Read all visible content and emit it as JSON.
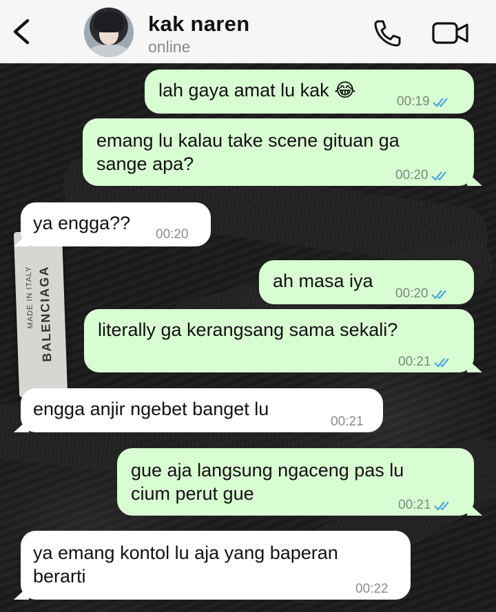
{
  "header": {
    "contact_name": "kak naren",
    "status": "online"
  },
  "wallpaper": {
    "tag_brand": "BALENCIAGA",
    "tag_subtext": "MADE IN ITALY"
  },
  "messages": [
    {
      "direction": "outgoing",
      "lines": [
        "lah gaya amat lu kak 😂"
      ],
      "time": "00:19",
      "read": true
    },
    {
      "direction": "outgoing",
      "lines": [
        "emang lu kalau take scene gituan ga",
        "sange apa?"
      ],
      "time": "00:20",
      "read": true
    },
    {
      "direction": "incoming",
      "lines": [
        "ya engga??"
      ],
      "time": "00:20"
    },
    {
      "direction": "outgoing",
      "lines": [
        "ah masa iya"
      ],
      "time": "00:20",
      "read": true
    },
    {
      "direction": "outgoing",
      "lines": [
        "literally ga kerangsang sama sekali?"
      ],
      "time": "00:21",
      "read": true
    },
    {
      "direction": "incoming",
      "lines": [
        "engga anjir ngebet banget lu"
      ],
      "time": "00:21"
    },
    {
      "direction": "outgoing",
      "lines": [
        "gue aja langsung ngaceng pas lu",
        "cium perut gue"
      ],
      "time": "00:21",
      "read": true
    },
    {
      "direction": "incoming",
      "lines": [
        "ya emang kontol lu aja yang baperan",
        "berarti"
      ],
      "time": "00:22"
    }
  ],
  "colors": {
    "outgoing_bubble": "#d9fdd3",
    "incoming_bubble": "#ffffff",
    "read_ticks": "#4fa3e0",
    "header_bg": "#f6f6f6"
  },
  "icons": [
    "chevron-left-icon",
    "phone-icon",
    "video-camera-icon",
    "double-check-icon"
  ]
}
